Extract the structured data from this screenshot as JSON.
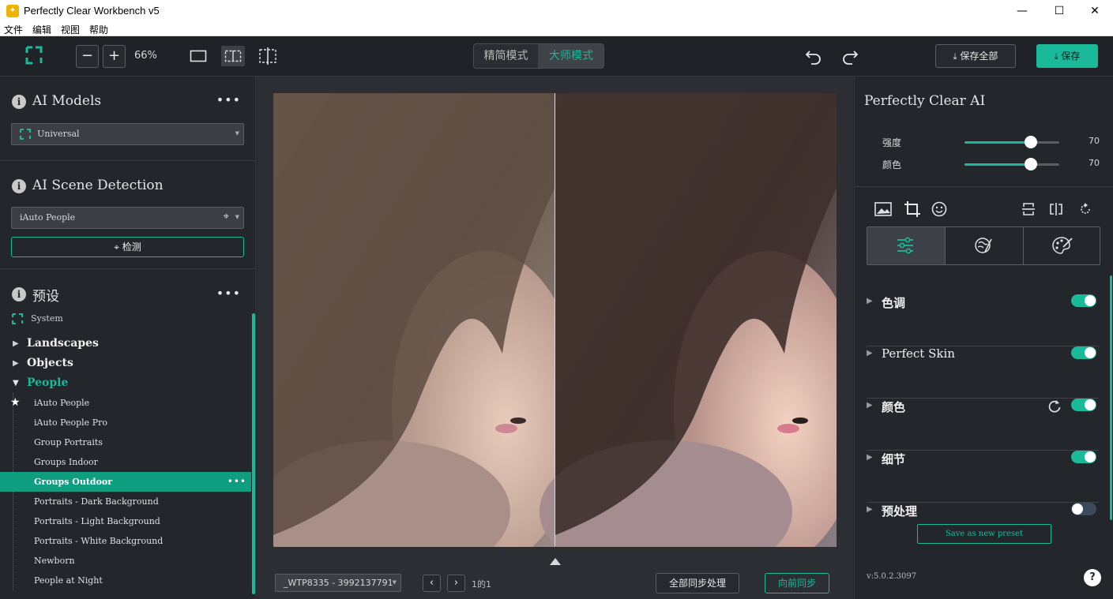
{
  "window": {
    "title": "Perfectly Clear Workbench v5",
    "minimize": "—",
    "maximize": "☐",
    "close": "✕"
  },
  "menu": [
    "文件",
    "编辑",
    "视图",
    "帮助"
  ],
  "toolbar": {
    "zoom_out": "−",
    "zoom_in": "+",
    "zoom_level": "66%",
    "mode_simple": "精简模式",
    "mode_master": "大师模式",
    "save_all": "保存全部",
    "save": "保存"
  },
  "left": {
    "ai_models_title": "AI Models",
    "ai_model_value": "Universal",
    "scene_title": "AI Scene Detection",
    "scene_value": "iAuto People",
    "detect_label": "检测",
    "presets_title": "预设",
    "system_label": "System",
    "categories": [
      "Landscapes",
      "Objects",
      "People"
    ],
    "people_presets": [
      "iAuto People",
      "iAuto People Pro",
      "Group Portraits",
      "Groups Indoor",
      "Groups Outdoor",
      "Portraits - Dark Background",
      "Portraits - Light Background",
      "Portraits - White Background",
      "Newborn",
      "People at Night"
    ],
    "selected_preset": "Groups Outdoor"
  },
  "center": {
    "file_name": "_WTP8335 - 3992137791",
    "page_info": "1的1",
    "sync_all": "全部同步处理",
    "sync_forward": "向前同步"
  },
  "right": {
    "title": "Perfectly Clear AI",
    "strength_label": "强度",
    "strength_value": 70,
    "color_label": "颜色",
    "color_value": 70,
    "adjustments": [
      {
        "label": "色调",
        "on": true
      },
      {
        "label": "Perfect Skin",
        "on": true
      },
      {
        "label": "颜色",
        "on": true
      },
      {
        "label": "细节",
        "on": true
      },
      {
        "label": "预处理",
        "on": false
      }
    ],
    "save_preset": "Save as new preset",
    "version": "v:5.0.2.3097",
    "help": "?"
  },
  "colors": {
    "accent": "#1ab99a",
    "selected_row": "#0f9e80",
    "panel": "#23262b"
  }
}
